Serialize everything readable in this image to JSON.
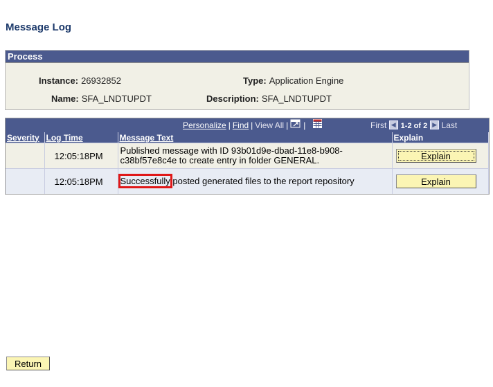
{
  "page": {
    "title": "Message Log"
  },
  "process": {
    "header": "Process",
    "instance_label": "Instance:",
    "instance_value": "26932852",
    "type_label": "Type:",
    "type_value": "Application Engine",
    "name_label": "Name:",
    "name_value": "SFA_LNDTUPDT",
    "description_label": "Description:",
    "description_value": "SFA_LNDTUPDT"
  },
  "grid": {
    "nav": {
      "personalize": "Personalize",
      "find": "Find",
      "view_all": "View All",
      "first": "First",
      "range": "1-2 of 2",
      "last": "Last",
      "separator": "|"
    },
    "columns": [
      "Severity",
      "Log Time",
      "Message Text",
      "Explain"
    ],
    "rows": [
      {
        "severity": "",
        "log_time": "12:05:18PM",
        "message": "Published message with ID 93b01d9e-dbad-11e8-b908-c38bf57e8c4e to create entry in folder GENERAL.",
        "explain_label": "Explain"
      },
      {
        "severity": "",
        "log_time": "12:05:18PM",
        "message_highlight": "Successfully",
        "message_rest": " posted generated files to the report repository",
        "explain_label": "Explain"
      }
    ]
  },
  "footer": {
    "return_label": "Return"
  },
  "colors": {
    "header_bg": "#4b5a8e",
    "title_text": "#1d3a6b",
    "panel_bg": "#f1f0e6",
    "button_bg": "#fbf5b4",
    "highlight_border": "#e01818"
  },
  "icons": {
    "new_window": "new-window-icon",
    "download": "download-to-excel-icon",
    "first_arrow": "first-arrow-icon",
    "next_arrow": "next-arrow-icon"
  }
}
